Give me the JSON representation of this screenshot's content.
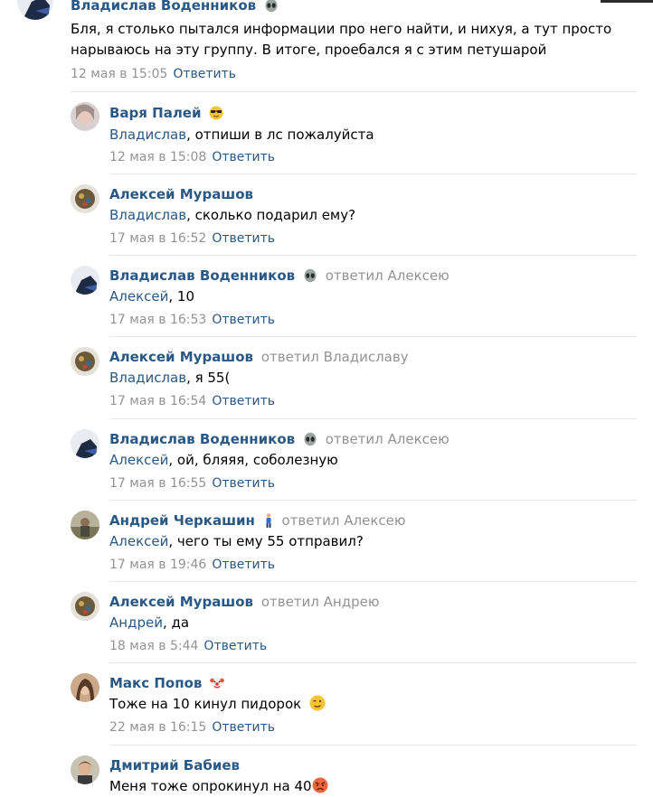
{
  "top_comment": {
    "author": "Владислав Воденников",
    "author_emoji": "alien-emoji",
    "text": "Бля, я столько пытался информации про него найти, и нихуя, а тут просто нарываюсь на эту группу. В итоге, проебался я с этим петушарой",
    "date": "12 мая в 15:05",
    "reply_label": "Ответить"
  },
  "replies": [
    {
      "author": "Варя Палей",
      "author_emoji": "sunglasses-emoji",
      "reply_to": "",
      "mention": "Владислав",
      "text": ", отпиши в лс пожалуйста",
      "date": "12 мая в 15:08",
      "reply_label": "Ответить"
    },
    {
      "author": "Алексей Мурашов",
      "author_emoji": "",
      "reply_to": "",
      "mention": "Владислав",
      "text": ", сколько подарил ему?",
      "date": "17 мая в 16:52",
      "reply_label": "Ответить"
    },
    {
      "author": "Владислав Воденников",
      "author_emoji": "alien-emoji",
      "reply_to": "ответил Алексею",
      "mention": "Алексей",
      "text": ", 10",
      "date": "17 мая в 16:53",
      "reply_label": "Ответить"
    },
    {
      "author": "Алексей Мурашов",
      "author_emoji": "",
      "reply_to": "ответил Владиславу",
      "mention": "Владислав",
      "text": ", я 55(",
      "date": "17 мая в 16:54",
      "reply_label": "Ответить"
    },
    {
      "author": "Владислав Воденников",
      "author_emoji": "alien-emoji",
      "reply_to": "ответил Алексею",
      "mention": "Алексей",
      "text": ", ой, бляяя, соболезную",
      "date": "17 мая в 16:55",
      "reply_label": "Ответить"
    },
    {
      "author": "Андрей Черкашин",
      "author_emoji": "person-emoji",
      "reply_to": "ответил Алексею",
      "mention": "Алексей",
      "text": ", чего ты ему 55 отправил?",
      "date": "17 мая в 19:46",
      "reply_label": "Ответить"
    },
    {
      "author": "Алексей Мурашов",
      "author_emoji": "",
      "reply_to": "ответил Андрею",
      "mention": "Андрей",
      "text": ", да",
      "date": "18 мая в 5:44",
      "reply_label": "Ответить"
    },
    {
      "author": "Макс Попов",
      "author_emoji": "clown-emoji",
      "reply_to": "",
      "mention": "",
      "text": "Тоже на 10 кинул пидорок",
      "text_emoji": "winking-face-emoji",
      "date": "22 мая в 16:15",
      "reply_label": "Ответить"
    },
    {
      "author": "Дмитрий Бабиев",
      "author_emoji": "",
      "reply_to": "",
      "mention": "",
      "text": "Меня тоже опрокинул на 40",
      "text_emoji": "angry-face-emoji",
      "date": "",
      "reply_label": ""
    }
  ],
  "colors": {
    "link": "#2a5885",
    "muted": "#939393",
    "divider": "#e7e8ec"
  }
}
